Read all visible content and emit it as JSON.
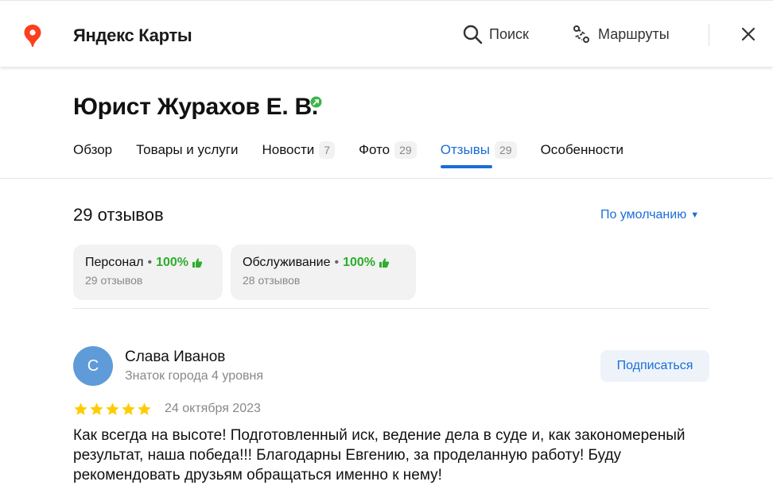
{
  "header": {
    "app_title": "Яндекс Карты",
    "search_label": "Поиск",
    "routes_label": "Маршруты",
    "logo_icon": "map-pin-icon",
    "accent_color": "#fc3f1d"
  },
  "organization": {
    "name": "Юрист Журахов Е. В.",
    "verified": true
  },
  "tabs": [
    {
      "label": "Обзор",
      "count": null
    },
    {
      "label": "Товары и услуги",
      "count": null
    },
    {
      "label": "Новости",
      "count": "7"
    },
    {
      "label": "Фото",
      "count": "29"
    },
    {
      "label": "Отзывы",
      "count": "29",
      "active": true
    },
    {
      "label": "Особенности",
      "count": null
    }
  ],
  "reviews": {
    "total_label": "29 отзывов",
    "sort_label": "По умолчанию",
    "aspects": [
      {
        "name": "Персонал",
        "percent": "100%",
        "count_label": "29 отзывов"
      },
      {
        "name": "Обслуживание",
        "percent": "100%",
        "count_label": "28 отзывов"
      }
    ],
    "items": [
      {
        "avatar_letter": "С",
        "author": "Слава Иванов",
        "level": "Знаток города 4 уровня",
        "subscribe_label": "Подписаться",
        "rating": 5,
        "date": "24 октября 2023",
        "text": "Как всегда на высоте! Подготовленный иск, ведение дела в суде и, как закономереный результат, наша победа!!! Благодарны Евгению, за проделанную работу! Буду рекомендовать друзьям обращаться именно к нему!"
      }
    ]
  },
  "colors": {
    "link": "#1a6dd8",
    "positive": "#2cae2c",
    "star": "#fc0",
    "avatar": "#5f9bd9"
  }
}
